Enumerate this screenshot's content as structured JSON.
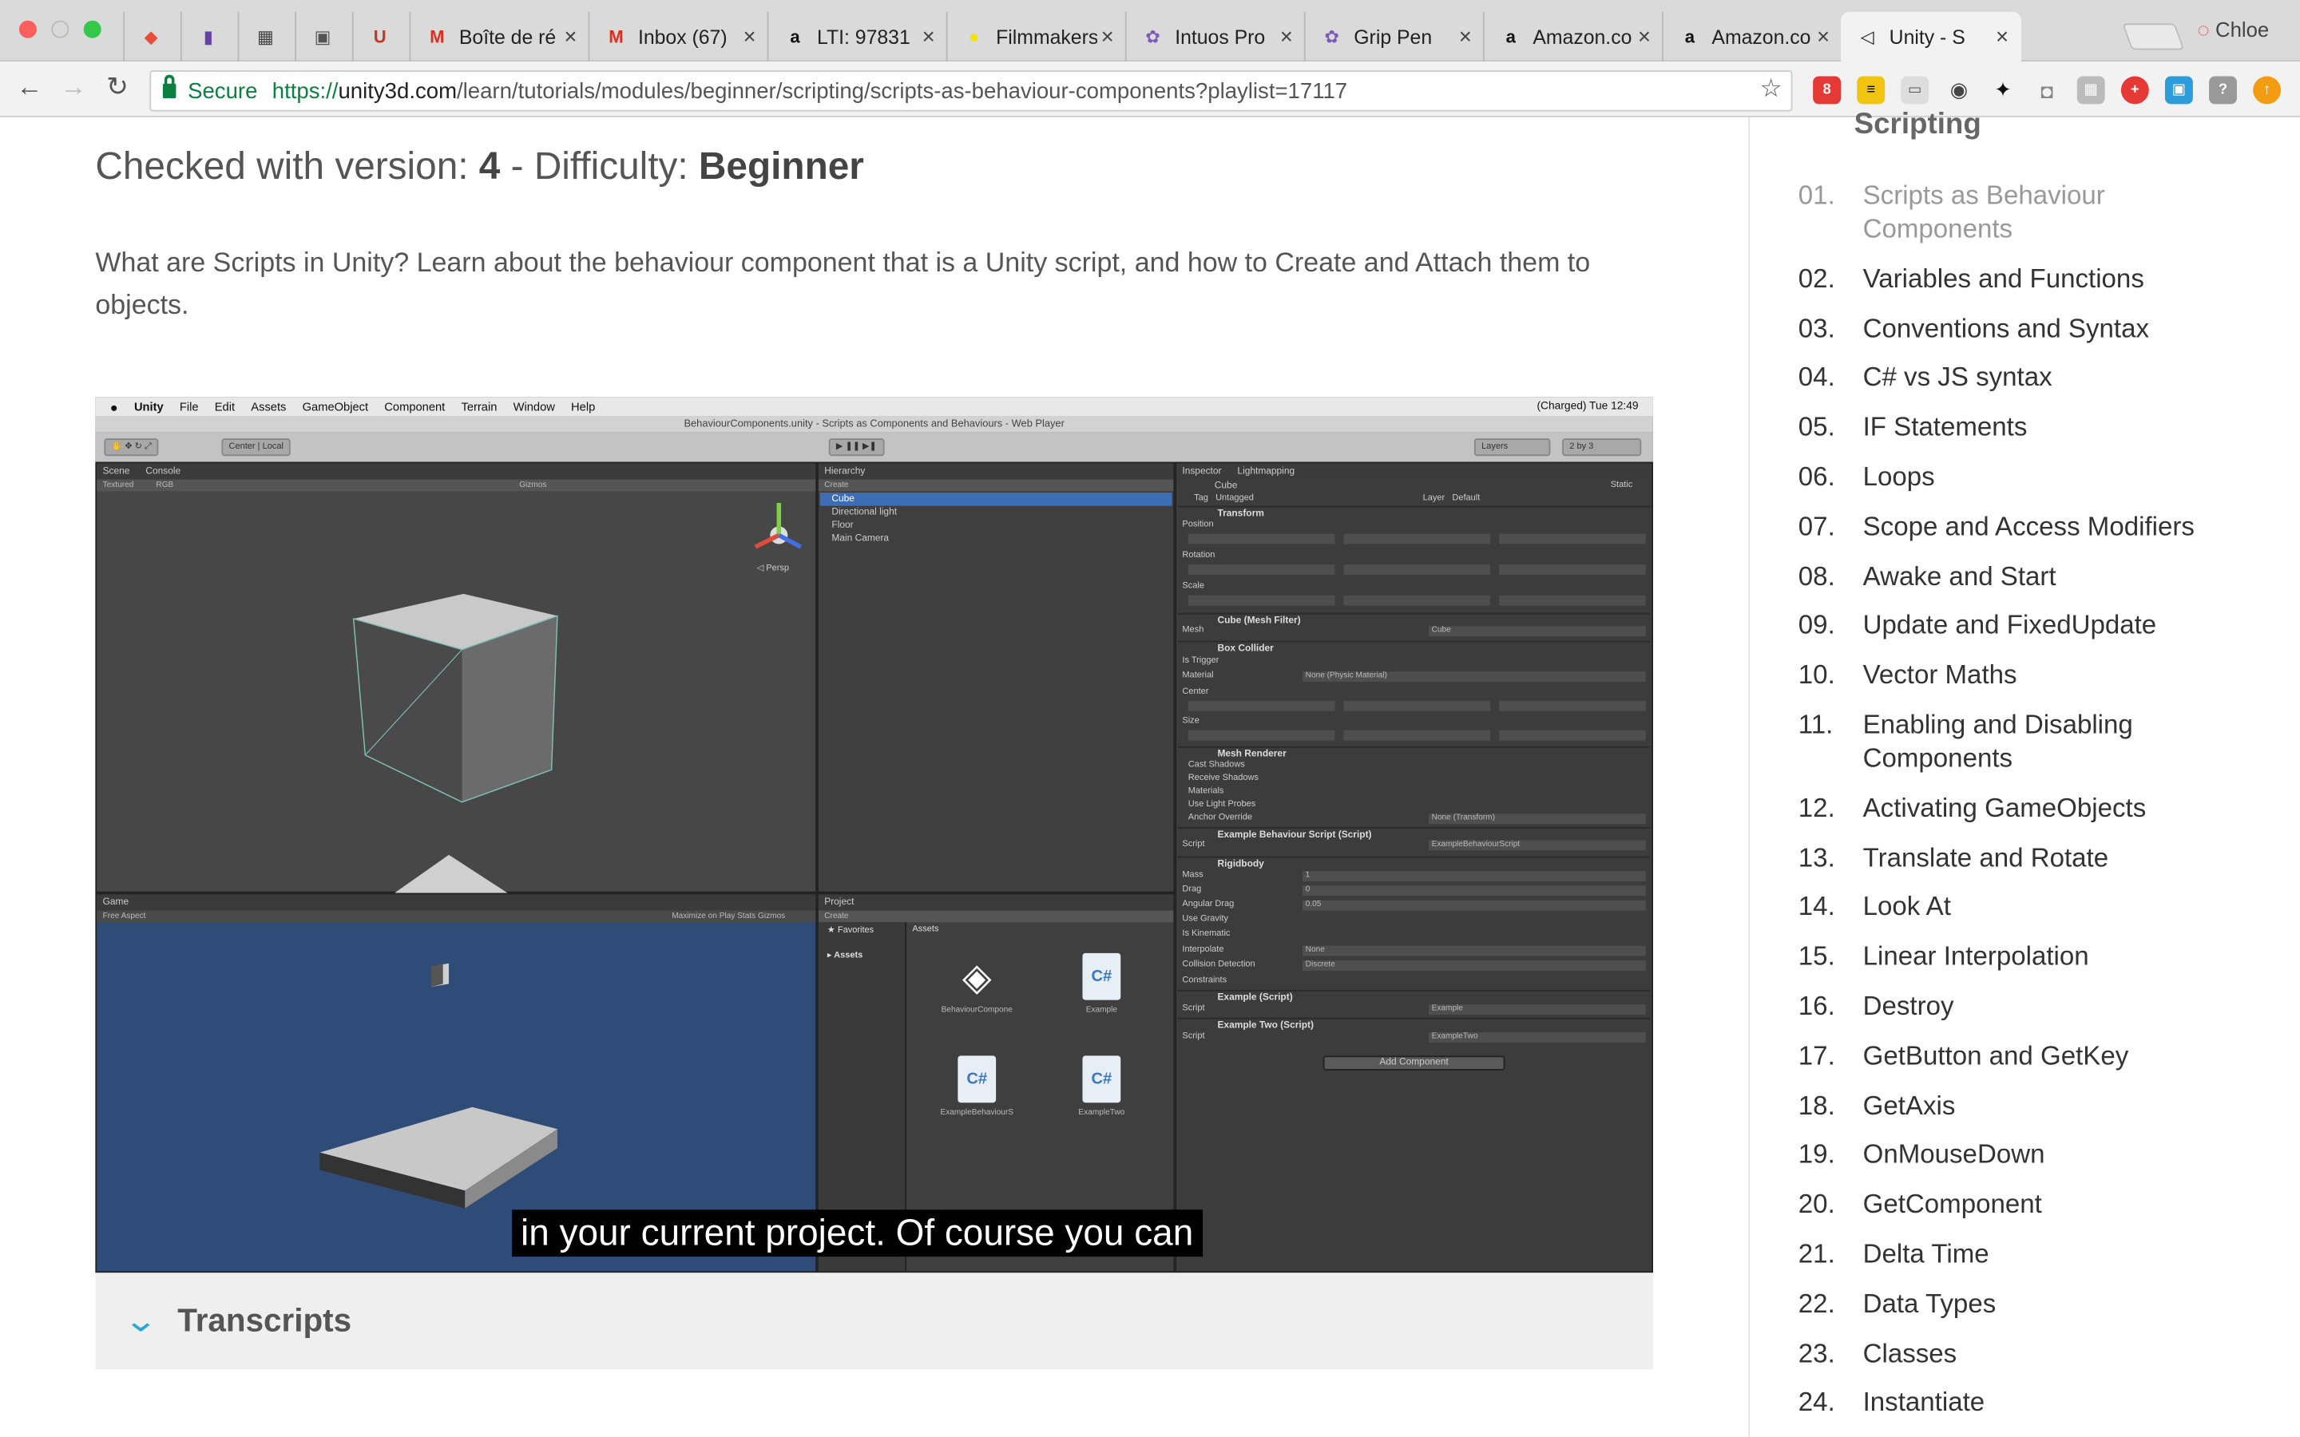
{
  "browser": {
    "tabs": [
      {
        "title": "",
        "icon": "rainbow-icon",
        "color": "#e74c3c"
      },
      {
        "title": "",
        "icon": "twitch-icon",
        "color": "#6441a4"
      },
      {
        "title": "",
        "icon": "grid-app-icon",
        "color": "#444444"
      },
      {
        "title": "",
        "icon": "app-icon",
        "color": "#555555"
      },
      {
        "title": "",
        "icon": "uc-icon",
        "color": "#c0392b"
      },
      {
        "title": "Boîte de ré",
        "icon": "gmail-icon",
        "color": "#d93025"
      },
      {
        "title": "Inbox (67)",
        "icon": "gmail-icon",
        "color": "#d93025"
      },
      {
        "title": "LTI: 97831",
        "icon": "amazon-icon",
        "color": "#111111"
      },
      {
        "title": "Filmmakers",
        "icon": "yellow-circle-icon",
        "color": "#f4e400"
      },
      {
        "title": "Intuos Pro",
        "icon": "wacom-icon",
        "color": "#7a5bb5"
      },
      {
        "title": "Grip Pen",
        "icon": "wacom-icon",
        "color": "#7a5bb5"
      },
      {
        "title": "Amazon.co",
        "icon": "amazon-icon",
        "color": "#111111"
      },
      {
        "title": "Amazon.co",
        "icon": "amazon-icon",
        "color": "#111111"
      },
      {
        "title": "Unity - S",
        "icon": "unity-icon",
        "color": "#222222"
      }
    ],
    "profile": "Chloe",
    "secure_label": "Secure",
    "url_scheme": "https://",
    "url_host": "unity3d.com",
    "url_path": "/learn/tutorials/modules/beginner/scripting/scripts-as-behaviour-components?playlist=17117"
  },
  "page": {
    "version_label": "Checked with version: ",
    "version_value": "4",
    "sep": " - ",
    "difficulty_label": "Difficulty: ",
    "difficulty_value": "Beginner",
    "description": "What are Scripts in Unity? Learn about the behaviour component that is a Unity script, and how to Create and Attach them to objects.",
    "transcripts_label": "Transcripts",
    "accent": "#2aa8d6"
  },
  "video": {
    "subtitle": "in your current project. Of course you can",
    "menubar": [
      "Unity",
      "File",
      "Edit",
      "Assets",
      "GameObject",
      "Component",
      "Terrain",
      "Window",
      "Help"
    ],
    "menubar_status": "(Charged)  Tue 12:49",
    "window_title": "BehaviourComponents.unity - Scripts as Components and Behaviours - Web Player",
    "toolbar": {
      "center": "Center",
      "local": "Local",
      "layers": "Layers",
      "layout": "2 by 3"
    },
    "scene": {
      "tab": "Scene",
      "tab2": "Console",
      "shading": "Textured",
      "rgb": "RGB",
      "gizmos": "Gizmos",
      "persp": "Persp"
    },
    "game": {
      "tab": "Game",
      "aspect": "Free Aspect",
      "options": "Maximize on Play   Stats   Gizmos"
    },
    "hierarchy": {
      "tab": "Hierarchy",
      "create": "Create",
      "items": [
        "Cube",
        "Directional light",
        "Floor",
        "Main Camera"
      ]
    },
    "project": {
      "tab": "Project",
      "create": "Create",
      "favorites": "Favorites",
      "assets": "Assets",
      "assets_folder": "Assets",
      "items": [
        "BehaviourCompone",
        "Example",
        "ExampleBehaviourS",
        "ExampleTwo"
      ]
    },
    "inspector": {
      "tab": "Inspector",
      "tab2": "Lightmapping",
      "object": "Cube",
      "static": "Static",
      "tag_label": "Tag",
      "tag": "Untagged",
      "layer_label": "Layer",
      "layer": "Default",
      "components": [
        "Transform",
        "Cube (Mesh Filter)",
        "Box Collider",
        "Mesh Renderer",
        "Example Behaviour Script (Script)",
        "Rigidbody",
        "Example (Script)",
        "Example Two (Script)"
      ],
      "fields": [
        "Position",
        "Rotation",
        "Scale",
        "Mesh",
        "Is Trigger",
        "Material",
        "Center",
        "Size",
        "Cast Shadows",
        "Receive Shadows",
        "Materials",
        "Use Light Probes",
        "Anchor Override",
        "Script",
        "Mass",
        "Drag",
        "Angular Drag",
        "Use Gravity",
        "Is Kinematic",
        "Interpolate",
        "Collision Detection",
        "Constraints",
        "Script",
        "Script"
      ],
      "values": {
        "mesh": "Cube",
        "material": "None (Physic Material)",
        "anchor": "None (Transform)",
        "script1": "ExampleBehaviourScript",
        "mass": "1",
        "drag": "0",
        "angular_drag": "0.05",
        "interpolate": "None",
        "collision": "Discrete",
        "script2": "Example",
        "script3": "ExampleTwo"
      },
      "add_component": "Add Component"
    }
  },
  "sidebar": {
    "title": "Scripting",
    "items": [
      {
        "n": "01.",
        "t": "Scripts as Behaviour Components"
      },
      {
        "n": "02.",
        "t": "Variables and Functions"
      },
      {
        "n": "03.",
        "t": "Conventions and Syntax"
      },
      {
        "n": "04.",
        "t": "C# vs JS syntax"
      },
      {
        "n": "05.",
        "t": "IF Statements"
      },
      {
        "n": "06.",
        "t": "Loops"
      },
      {
        "n": "07.",
        "t": "Scope and Access Modifiers"
      },
      {
        "n": "08.",
        "t": "Awake and Start"
      },
      {
        "n": "09.",
        "t": "Update and FixedUpdate"
      },
      {
        "n": "10.",
        "t": "Vector Maths"
      },
      {
        "n": "11.",
        "t": "Enabling and Disabling Components"
      },
      {
        "n": "12.",
        "t": "Activating GameObjects"
      },
      {
        "n": "13.",
        "t": "Translate and Rotate"
      },
      {
        "n": "14.",
        "t": "Look At"
      },
      {
        "n": "15.",
        "t": "Linear Interpolation"
      },
      {
        "n": "16.",
        "t": "Destroy"
      },
      {
        "n": "17.",
        "t": "GetButton and GetKey"
      },
      {
        "n": "18.",
        "t": "GetAxis"
      },
      {
        "n": "19.",
        "t": "OnMouseDown"
      },
      {
        "n": "20.",
        "t": "GetComponent"
      },
      {
        "n": "21.",
        "t": "Delta Time"
      },
      {
        "n": "22.",
        "t": "Data Types"
      },
      {
        "n": "23.",
        "t": "Classes"
      },
      {
        "n": "24.",
        "t": "Instantiate"
      }
    ]
  }
}
